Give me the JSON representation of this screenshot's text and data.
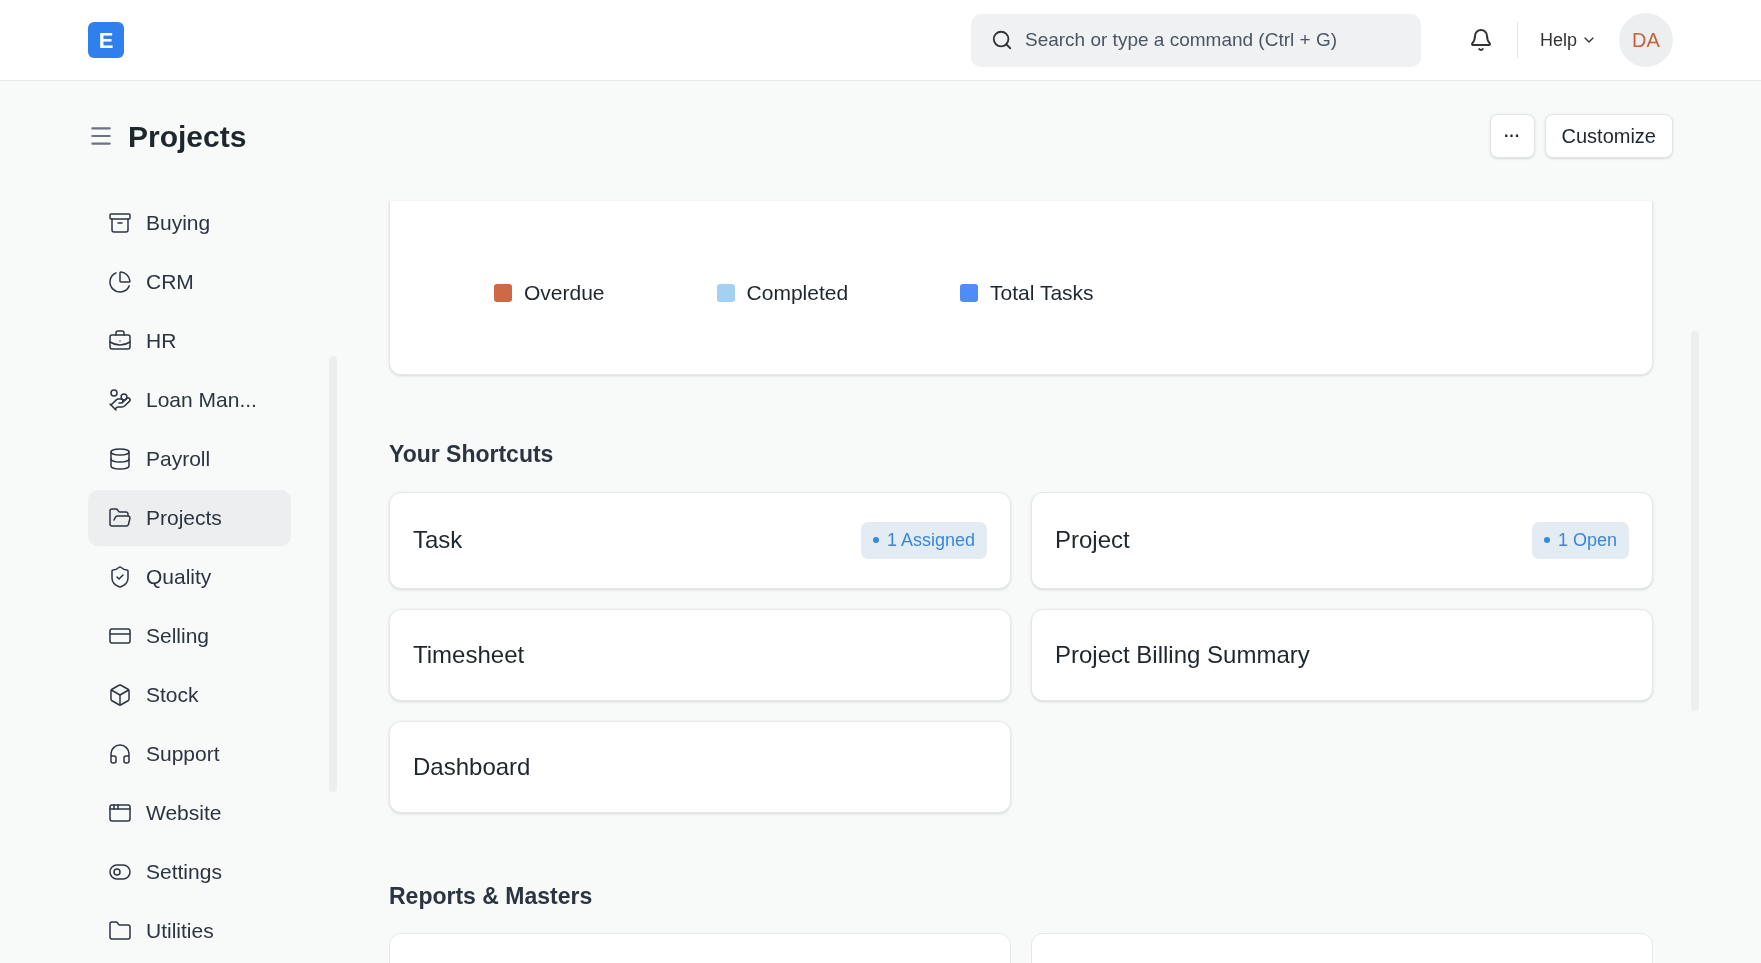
{
  "header": {
    "logo": "E",
    "search": {
      "placeholder": "Search or type a command (Ctrl + G)"
    },
    "help": "Help",
    "avatar": "DA"
  },
  "page": {
    "title": "Projects",
    "more": "···",
    "customize": "Customize"
  },
  "sidebar": {
    "items": [
      {
        "label": "Buying",
        "selected": false
      },
      {
        "label": "CRM",
        "selected": false
      },
      {
        "label": "HR",
        "selected": false
      },
      {
        "label": "Loan Man...",
        "selected": false
      },
      {
        "label": "Payroll",
        "selected": false
      },
      {
        "label": "Projects",
        "selected": true
      },
      {
        "label": "Quality",
        "selected": false
      },
      {
        "label": "Selling",
        "selected": false
      },
      {
        "label": "Stock",
        "selected": false
      },
      {
        "label": "Support",
        "selected": false
      },
      {
        "label": "Website",
        "selected": false
      },
      {
        "label": "Settings",
        "selected": false
      },
      {
        "label": "Utilities",
        "selected": false
      }
    ]
  },
  "chart_legend": [
    {
      "label": "Overdue",
      "color": "#cb6a44"
    },
    {
      "label": "Completed",
      "color": "#a3d0f3"
    },
    {
      "label": "Total Tasks",
      "color": "#4f8cf7"
    }
  ],
  "shortcuts": {
    "title": "Your Shortcuts",
    "items": [
      {
        "label": "Task",
        "badge": "1 Assigned"
      },
      {
        "label": "Project",
        "badge": "1 Open"
      },
      {
        "label": "Timesheet"
      },
      {
        "label": "Project Billing Summary"
      },
      {
        "label": "Dashboard"
      }
    ]
  },
  "reports": {
    "title": "Reports & Masters"
  }
}
